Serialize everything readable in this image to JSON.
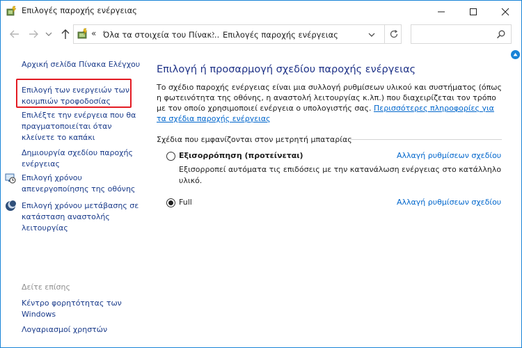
{
  "window": {
    "title": "Επιλογές παροχής ενέργειας"
  },
  "address": {
    "chevron": "«",
    "crumb1": "Όλα τα στοιχεία του Πίνακ...",
    "separator": "›",
    "crumb2": "Επιλογές παροχής ενέργειας"
  },
  "search": {
    "placeholder": ""
  },
  "sidebar": {
    "home": "Αρχική σελίδα Πίνακα Ελέγχου",
    "items": [
      {
        "label": "Επιλογή των ενεργειών των κουμπιών τροφοδοσίας"
      },
      {
        "label": "Επιλέξτε την ενέργεια που θα πραγματοποιείται όταν κλείνετε το καπάκι"
      },
      {
        "label": "Δημιουργία σχεδίου παροχής ενέργειας"
      },
      {
        "label": "Επιλογή χρόνου απενεργοποίησης της οθόνης",
        "icon": "display-timer-icon"
      },
      {
        "label": "Επιλογή χρόνου μετάβασης σε κατάσταση αναστολής λειτουργίας",
        "icon": "sleep-moon-icon"
      }
    ],
    "see_also": "Δείτε επίσης",
    "see_also_items": [
      {
        "label": "Κέντρο φορητότητας των Windows"
      },
      {
        "label": "Λογαριασμοί χρηστών"
      }
    ]
  },
  "main": {
    "title": "Επιλογή ή προσαρμογή σχεδίου παροχής ενέργειας",
    "description": "Το σχέδιο παροχής ενέργειας είναι μια συλλογή ρυθμίσεων υλικού και συστήματος (όπως η φωτεινότητα της οθόνης, η αναστολή λειτουργίας κ.λπ.) που διαχειρίζεται τον τρόπο με τον οποίο χρησιμοποιεί ενέργεια ο υπολογιστής σας. ",
    "more_link": "Περισσότερες πληροφορίες για τα σχέδια παροχής ενέργειας",
    "section_heading": "Σχέδια που εμφανίζονται στον μετρητή μπαταρίας",
    "plans": [
      {
        "name": "Εξισορρόπηση (προτείνεται)",
        "description": "Εξισορροπεί αυτόματα τις επιδόσεις με την κατανάλωση ενέργειας στο κατάλληλο υλικό.",
        "change_link": "Αλλαγή ρυθμίσεων σχεδίου",
        "selected": false
      },
      {
        "name": "Full",
        "description": "",
        "change_link": "Αλλαγή ρυθμίσεων σχεδίου",
        "selected": true
      }
    ]
  },
  "colors": {
    "accent": "#1883d7",
    "link": "#0066cc",
    "nav_link": "#1a3b8a",
    "title": "#1e3287",
    "highlight": "#e31b23"
  }
}
